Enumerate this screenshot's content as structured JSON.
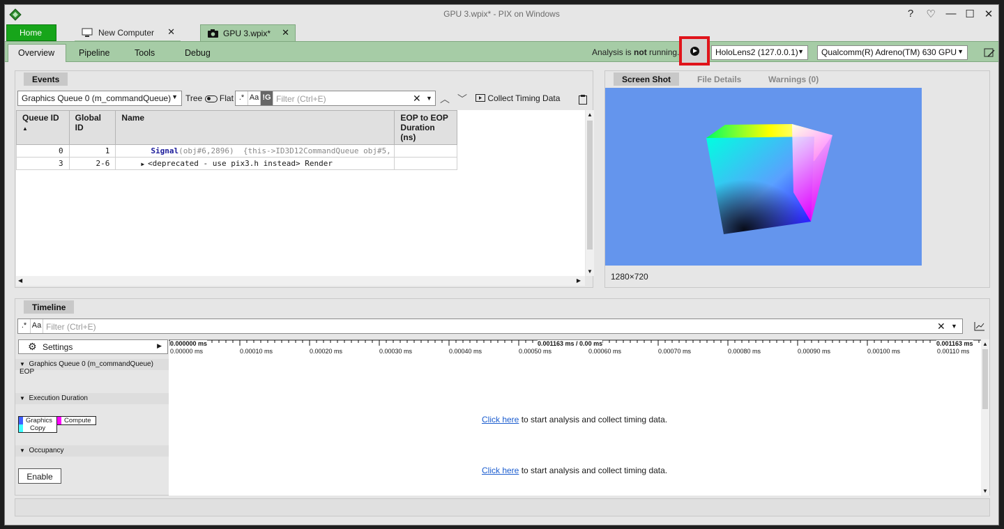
{
  "window": {
    "title": "GPU 3.wpix* - PIX on Windows",
    "controls": [
      "?",
      "♡",
      "—",
      "☐",
      "✕"
    ]
  },
  "doc_tabs": {
    "home": "Home",
    "new_computer": "New Computer",
    "gpu": "GPU 3.wpix*"
  },
  "view_tabs": [
    "Overview",
    "Pipeline",
    "Tools",
    "Debug"
  ],
  "analysis": {
    "prefix": "Analysis is ",
    "status": "not",
    "suffix": " running.",
    "device": "HoloLens2 (127.0.0.1)",
    "gpu": "Qualcomm(R) Adreno(TM) 630 GPU"
  },
  "events": {
    "tab": "Events",
    "queue": "Graphics Queue 0 (m_commandQueue)",
    "tree_label": "Tree",
    "flat_label": "Flat",
    "regex_btn": ".*",
    "case_btn": "Aa",
    "group_btn": "!G",
    "filter_placeholder": "Filter (Ctrl+E)",
    "collect_label": "Collect Timing Data",
    "columns": [
      "Queue ID",
      "Global ID",
      "Name",
      "EOP to EOP\nDuration (ns)"
    ],
    "rows": [
      {
        "queue_id": "0",
        "global_id": "1",
        "name_fn": "Signal",
        "name_args": "(obj#6,2896)",
        "name_rest": "  {this->ID3D12CommandQueue obj#5,",
        "duration": ""
      },
      {
        "queue_id": "3",
        "global_id": "2-6",
        "name_fn": "",
        "name_args": "",
        "name_rest": "<deprecated - use pix3.h instead> Render",
        "duration": ""
      }
    ]
  },
  "screenshot_panel": {
    "tabs": [
      "Screen Shot",
      "File Details",
      "Warnings (0)"
    ],
    "resolution": "1280×720",
    "bg_color": "#6495ed"
  },
  "timeline": {
    "tab": "Timeline",
    "regex_btn": ".*",
    "case_btn": "Aa",
    "filter_placeholder": "Filter (Ctrl+E)",
    "settings_label": "Settings",
    "start_label": "0.000000 ms",
    "mid_label": "0.001163 ms / 0.00 ms",
    "end_label": "0.001163 ms",
    "ticks": [
      "0.00000 ms",
      "0.00010 ms",
      "0.00020 ms",
      "0.00030 ms",
      "0.00040 ms",
      "0.00050 ms",
      "0.00060 ms",
      "0.00070 ms",
      "0.00080 ms",
      "0.00090 ms",
      "0.00100 ms",
      "0.00110 ms"
    ],
    "lanes": [
      "Graphics Queue 0 (m_commandQueue) EOP",
      "Execution Duration",
      "Occupancy"
    ],
    "legend": {
      "graphics": "Graphics",
      "compute": "Compute",
      "copy": "Copy"
    },
    "enable_label": "Enable",
    "click_here": "Click here",
    "click_rest": " to start analysis and collect timing data."
  }
}
